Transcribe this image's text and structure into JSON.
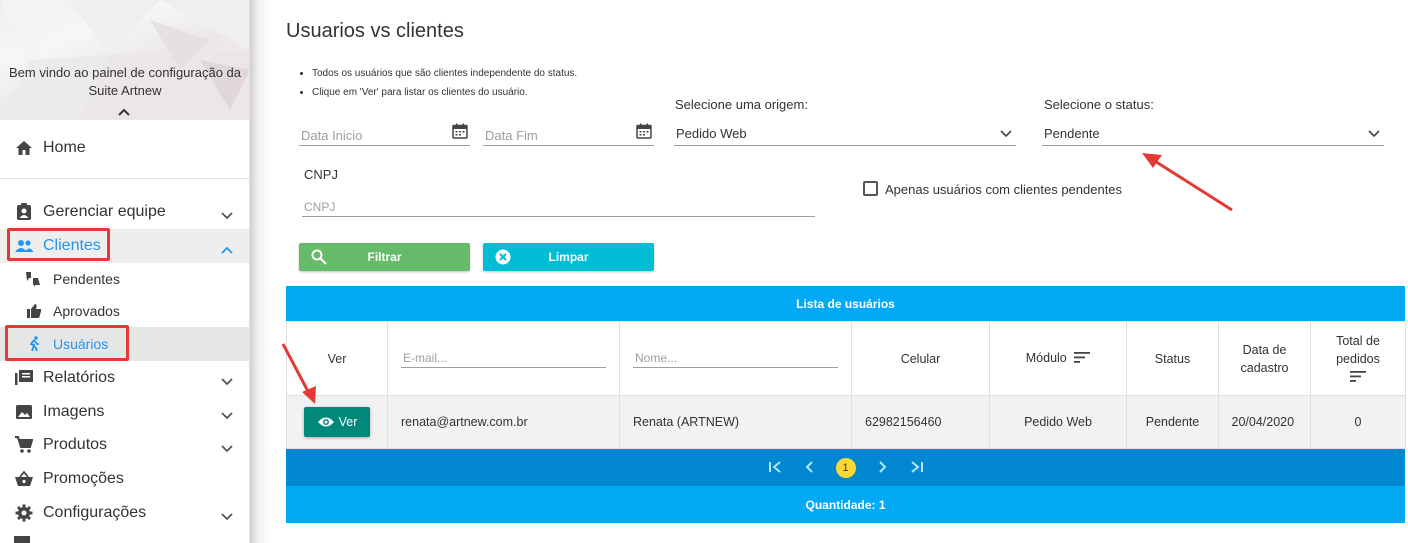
{
  "sidebar": {
    "welcome": "Bem vindo ao painel de configuração da Suite Artnew",
    "items": [
      {
        "label": "Home",
        "icon": "home-icon"
      },
      {
        "label": "Gerenciar equipe",
        "icon": "badge-icon"
      },
      {
        "label": "Clientes",
        "icon": "people-icon"
      },
      {
        "label": "Pendentes",
        "icon": "thumbs-updown-icon"
      },
      {
        "label": "Aprovados",
        "icon": "thumb-up-icon"
      },
      {
        "label": "Usuários",
        "icon": "run-icon"
      },
      {
        "label": "Relatórios",
        "icon": "library-icon"
      },
      {
        "label": "Imagens",
        "icon": "image-icon"
      },
      {
        "label": "Produtos",
        "icon": "cart-icon"
      },
      {
        "label": "Promoções",
        "icon": "basket-icon"
      },
      {
        "label": "Configurações",
        "icon": "gear-icon"
      }
    ]
  },
  "page": {
    "title": "Usuarios vs clientes",
    "bullets": [
      "Todos os usuários que são clientes independente do status.",
      "Clique em 'Ver' para listar os clientes do usuário."
    ]
  },
  "filters": {
    "data_inicio_placeholder": "Data Inicio",
    "data_fim_placeholder": "Data Fim",
    "origem_label": "Selecione uma origem:",
    "origem_value": "Pedido Web",
    "status_label": "Selecione o status:",
    "status_value": "Pendente",
    "cnpj_label": "CNPJ",
    "cnpj_placeholder": "CNPJ",
    "pending_only_label": "Apenas usuários com clientes pendentes",
    "pending_only_checked": false,
    "filter_button": "Filtrar",
    "clear_button": "Limpar"
  },
  "table": {
    "title": "Lista de usuários",
    "columns": {
      "ver": "Ver",
      "email_placeholder": "E-mail...",
      "nome_placeholder": "Nome...",
      "celular": "Celular",
      "modulo": "Módulo",
      "status": "Status",
      "data_cadastro": "Data de cadastro",
      "total_pedidos": "Total de pedidos"
    },
    "rows": [
      {
        "ver": "Ver",
        "email": "renata@artnew.com.br",
        "nome": "Renata (ARTNEW)",
        "celular": "62982156460",
        "modulo": "Pedido Web",
        "status": "Pendente",
        "data_cadastro": "20/04/2020",
        "total_pedidos": "0"
      }
    ],
    "pager": {
      "current_page": "1"
    },
    "footer": "Quantidade: 1"
  },
  "colors": {
    "accent": "#2196f3",
    "table_header": "#03a9f4",
    "pager": "#0288d1",
    "filter_btn": "#66bb6a",
    "clear_btn": "#00bcd4",
    "ver_btn": "#00897b",
    "highlight": "#e53935"
  }
}
